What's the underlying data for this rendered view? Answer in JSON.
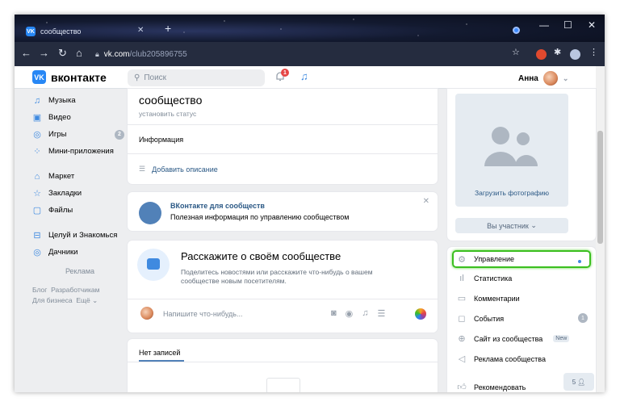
{
  "browser": {
    "tab_title": "сообщество",
    "url_host": "vk.com",
    "url_path": "/club205896755"
  },
  "header": {
    "logo_text": "вконтакте",
    "search_placeholder": "Поиск",
    "notif_count": "1",
    "user_name": "Анна"
  },
  "left_menu": {
    "items": [
      {
        "icon": "music-icon",
        "label": "Музыка"
      },
      {
        "icon": "video-icon",
        "label": "Видео"
      },
      {
        "icon": "gamepad-icon",
        "label": "Игры",
        "count": "2"
      },
      {
        "icon": "apps-icon",
        "label": "Мини-приложения"
      },
      {
        "icon": "shop-icon",
        "label": "Маркет"
      },
      {
        "icon": "star-icon",
        "label": "Закладки"
      },
      {
        "icon": "file-icon",
        "label": "Файлы"
      },
      {
        "icon": "cake-icon",
        "label": "Целуй и Знакомься"
      },
      {
        "icon": "gamepad-icon",
        "label": "Дачники"
      }
    ],
    "ad_label": "Реклама",
    "footer": {
      "blog": "Блог",
      "devs": "Разработчикам",
      "business": "Для бизнеса",
      "more": "Ещё"
    }
  },
  "community": {
    "name": "сообщество",
    "status": "установить статус",
    "info_label": "Информация",
    "add_description": "Добавить описание"
  },
  "promo": {
    "title": "ВКонтакте для сообществ",
    "text": "Полезная информация по управлению сообществом"
  },
  "tell": {
    "title": "Расскажите о своём сообществе",
    "text": "Поделитесь новостями или расскажите что-нибудь о вашем сообществе новым посетителям.",
    "placeholder": "Напишите что-нибудь..."
  },
  "posts": {
    "empty_tab": "Нет записей"
  },
  "right": {
    "upload_photo": "Загрузить фотографию",
    "member_button": "Вы участник",
    "menu": [
      {
        "icon": "gear-icon",
        "label": "Управление",
        "selected": true
      },
      {
        "icon": "stats-icon",
        "label": "Статистика"
      },
      {
        "icon": "comment-icon",
        "label": "Комментарии"
      },
      {
        "icon": "event-icon",
        "label": "События",
        "count": "1"
      },
      {
        "icon": "globe-icon",
        "label": "Сайт из сообщества",
        "tag": "New"
      },
      {
        "icon": "megaphone-icon",
        "label": "Реклама сообщества"
      },
      {
        "icon": "thumb-icon",
        "label": "Рекомендовать"
      }
    ],
    "chat_count": "5"
  },
  "colors": {
    "accent": "#2787f5",
    "link": "#2a5885",
    "highlight": "#3bbf1f"
  }
}
